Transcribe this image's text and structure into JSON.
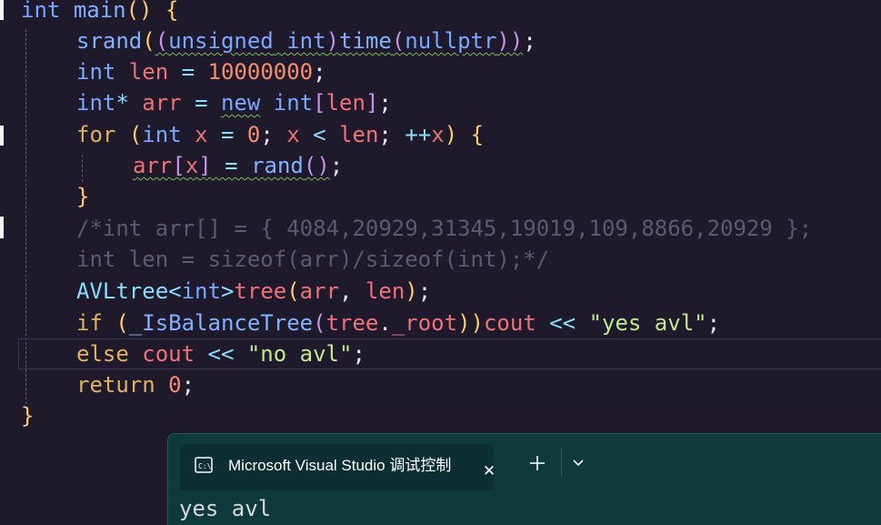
{
  "editor": {
    "lines": {
      "l1": {
        "kw_int": "int",
        "fn_main": "main",
        "parens": "()",
        "brace": " {"
      },
      "l2": {
        "fn_srand": "srand",
        "p1": "(",
        "p2": "(",
        "kw_unsigned": "unsigned",
        "sp": " ",
        "kw_int": "int",
        "p3": ")",
        "fn_time": "time",
        "p4": "(",
        "kw_nullptr": "nullptr",
        "p5": "))",
        "semi": ";"
      },
      "l3": {
        "kw_int": "int",
        "var_len": "len",
        "eq": " = ",
        "num": "10000000",
        "semi": ";"
      },
      "l4": {
        "kw_int": "int",
        "star": "*",
        "var_arr": "arr",
        "eq": " = ",
        "kw_new": "new",
        "lb": "[",
        "var_len": "len",
        "rb": "]",
        "semi": ";"
      },
      "l5": {
        "kw_for": "for",
        "lp": "(",
        "kw_int": "int",
        "var_x": "x",
        "eq": " = ",
        "num0": "0",
        "semi1": ";",
        "var_x2": "x",
        "lt": " < ",
        "var_len": "len",
        "semi2": ";",
        "inc": "++",
        "var_x3": "x",
        "rp": ")",
        "brace": " {"
      },
      "l6": {
        "var_arr": "arr",
        "lb": "[",
        "var_x": "x",
        "rb": "]",
        "eq": " = ",
        "fn_rand": "rand",
        "parens": "()",
        "semi": ";"
      },
      "l7": {
        "brace": "}"
      },
      "l8": {
        "comment": "/*int arr[] = { 4084,20929,31345,19019,109,8866,20929 };"
      },
      "l9": {
        "comment": "int len = sizeof(arr)/sizeof(int);*/"
      },
      "l10": {
        "cls": "AVLtree",
        "lt": "<",
        "kw_int": "int",
        "gt": ">",
        "var_tree": "tree",
        "lp": "(",
        "var_arr": "arr",
        "comma": ", ",
        "var_len": "len",
        "rp": ")",
        "semi": ";"
      },
      "l11": {
        "kw_if": "if",
        "lp": "(",
        "fn": "_IsBalanceTree",
        "lp2": "(",
        "var_tree": "tree",
        "dot": ".",
        "var_root": "_root",
        "rp2": "))",
        "var_cout": "cout",
        "shl": " << ",
        "str": "\"yes avl\"",
        "semi": ";"
      },
      "l12": {
        "kw_else": "else",
        "var_cout": "cout",
        "shl": " << ",
        "str": "\"no avl\"",
        "semi": ";"
      },
      "l13": {
        "kw_return": "return",
        "num": "0",
        "semi": ";"
      },
      "l14": {
        "brace": "}"
      }
    }
  },
  "terminal": {
    "tab_title": "Microsoft Visual Studio 调试控制台",
    "tab_icon": "console-icon",
    "close_symbol": "✕",
    "new_tab_icon": "plus-icon",
    "dropdown_icon": "chevron-down-icon",
    "output": "yes avl"
  }
}
